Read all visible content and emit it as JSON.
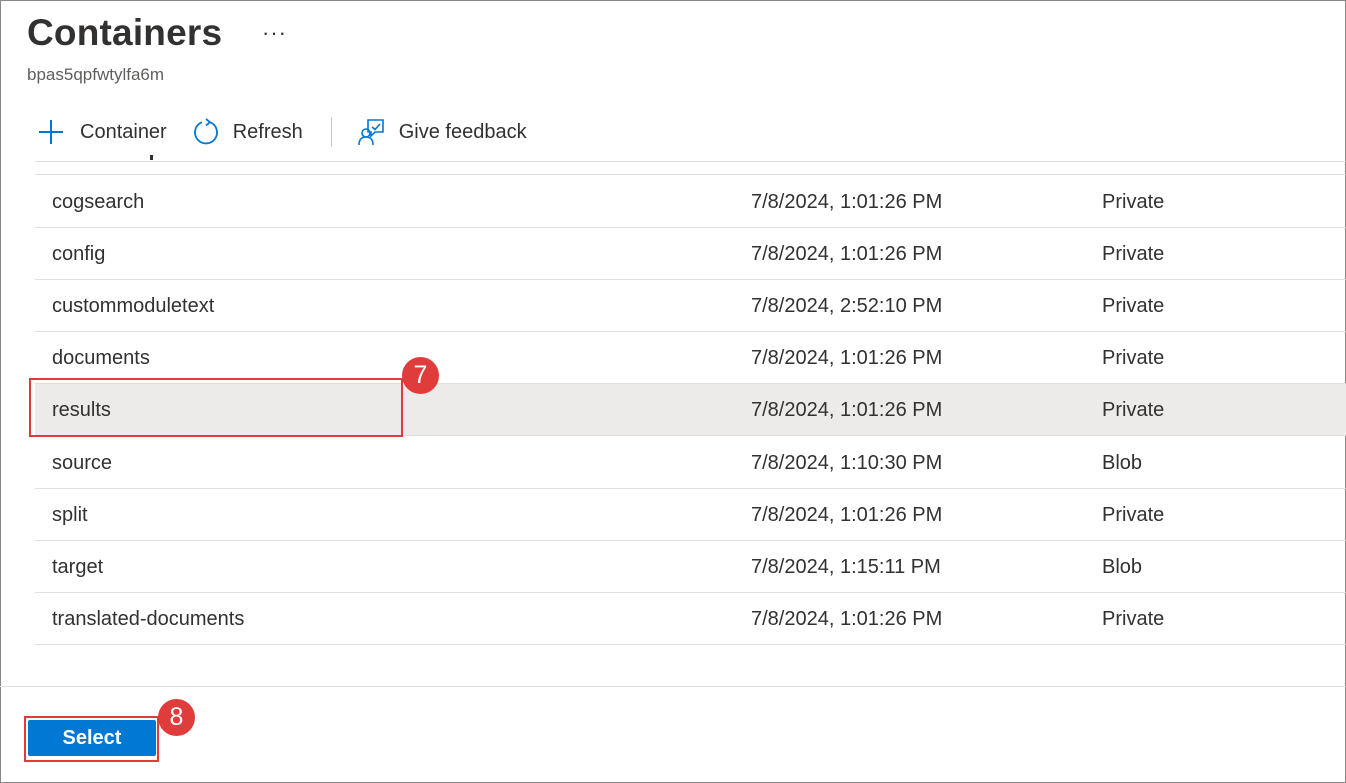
{
  "header": {
    "title": "Containers",
    "more_glyph": "···",
    "subtitle": "bpas5qpfwtylfa6m"
  },
  "toolbar": {
    "add_label": "Container",
    "refresh_label": "Refresh",
    "feedback_label": "Give feedback"
  },
  "table": {
    "rows": [
      {
        "name": "cogsearch",
        "modified": "7/8/2024, 1:01:26 PM",
        "access": "Private"
      },
      {
        "name": "config",
        "modified": "7/8/2024, 1:01:26 PM",
        "access": "Private"
      },
      {
        "name": "custommoduletext",
        "modified": "7/8/2024, 2:52:10 PM",
        "access": "Private"
      },
      {
        "name": "documents",
        "modified": "7/8/2024, 1:01:26 PM",
        "access": "Private"
      },
      {
        "name": "results",
        "modified": "7/8/2024, 1:01:26 PM",
        "access": "Private",
        "selected": true
      },
      {
        "name": "source",
        "modified": "7/8/2024, 1:10:30 PM",
        "access": "Blob"
      },
      {
        "name": "split",
        "modified": "7/8/2024, 1:01:26 PM",
        "access": "Private"
      },
      {
        "name": "target",
        "modified": "7/8/2024, 1:15:11 PM",
        "access": "Blob"
      },
      {
        "name": "translated-documents",
        "modified": "7/8/2024, 1:01:26 PM",
        "access": "Private"
      }
    ]
  },
  "footer": {
    "select_label": "Select"
  },
  "annotations": {
    "step7": "7",
    "step8": "8"
  },
  "colors": {
    "accent": "#0078d4",
    "highlight": "#e03c3c",
    "selected_row": "#edebe9"
  },
  "icons": [
    "plus-icon",
    "refresh-icon",
    "feedback-icon"
  ]
}
